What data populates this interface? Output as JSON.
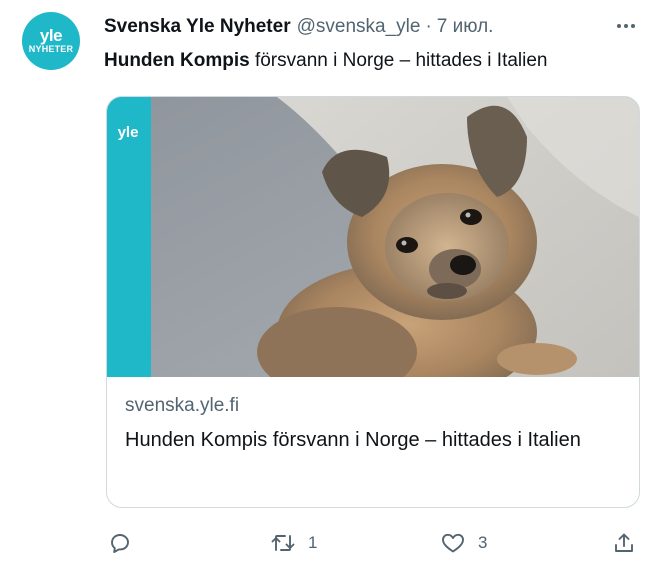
{
  "tweet": {
    "avatar": {
      "logo_word": "yle",
      "logo_sub": "NYHETER"
    },
    "display_name": "Svenska Yle Nyheter",
    "handle": "@svenska_yle",
    "separator": "·",
    "date": "7 июл.",
    "text_bold": "Hunden Kompis",
    "text_rest": " försvann i Norge – hittades i Italien"
  },
  "card": {
    "image_alt": "Small fluffy dog lying on a grey sofa",
    "badge_text": "yle",
    "domain": "svenska.yle.fi",
    "title": "Hunden Kompis försvann i Norge – hittades i Italien"
  },
  "actions": {
    "reply": {
      "icon": "reply-icon",
      "count": ""
    },
    "retweet": {
      "icon": "retweet-icon",
      "count": "1"
    },
    "like": {
      "icon": "heart-icon",
      "count": "3"
    },
    "share": {
      "icon": "share-icon",
      "count": ""
    }
  },
  "colors": {
    "brand_teal": "#1fb8c9",
    "text_primary": "#0f1419",
    "text_secondary": "#536471",
    "border": "#cfd9de"
  }
}
